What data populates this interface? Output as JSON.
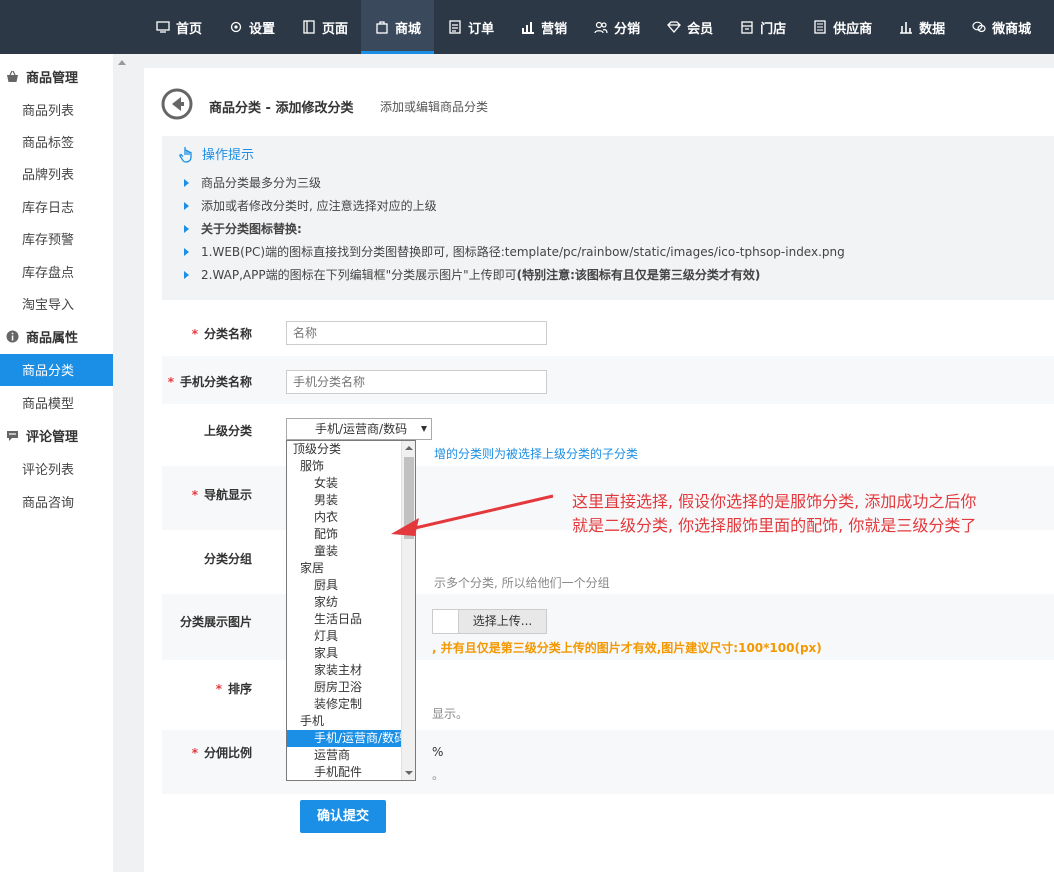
{
  "topnav": {
    "items": [
      {
        "label": "首页",
        "icon": "monitor-icon",
        "active": false
      },
      {
        "label": "设置",
        "icon": "gear-icon",
        "active": false
      },
      {
        "label": "页面",
        "icon": "page-icon",
        "active": false
      },
      {
        "label": "商城",
        "icon": "shopping-bag-icon",
        "active": true
      },
      {
        "label": "订单",
        "icon": "order-icon",
        "active": false
      },
      {
        "label": "营销",
        "icon": "bar-chart-icon",
        "active": false
      },
      {
        "label": "分销",
        "icon": "users-icon",
        "active": false
      },
      {
        "label": "会员",
        "icon": "diamond-icon",
        "active": false
      },
      {
        "label": "门店",
        "icon": "store-icon",
        "active": false
      },
      {
        "label": "供应商",
        "icon": "document-icon",
        "active": false
      },
      {
        "label": "数据",
        "icon": "stats-icon",
        "active": false
      },
      {
        "label": "微商城",
        "icon": "wechat-icon",
        "active": false
      }
    ],
    "accent": "#1b8fe6"
  },
  "sidebar": {
    "groups": [
      {
        "label": "商品管理",
        "icon": "basket-icon",
        "items": [
          "商品列表",
          "商品标签",
          "品牌列表",
          "库存日志",
          "库存预警",
          "库存盘点",
          "淘宝导入"
        ]
      },
      {
        "label": "商品属性",
        "icon": "info-icon",
        "items": [
          "商品分类",
          "商品模型"
        ]
      },
      {
        "label": "评论管理",
        "icon": "comment-icon",
        "items": [
          "评论列表",
          "商品咨询"
        ]
      }
    ],
    "active_item": "商品分类"
  },
  "header": {
    "title": "商品分类 - 添加修改分类",
    "subtitle": "添加或编辑商品分类"
  },
  "tips": {
    "title": "操作提示",
    "items": [
      {
        "text": "商品分类最多分为三级",
        "bold": false
      },
      {
        "text": "添加或者修改分类时, 应注意选择对应的上级",
        "bold": false
      },
      {
        "text": "关于分类图标替换:",
        "bold": true
      },
      {
        "text": "1.WEB(PC)端的图标直接找到分类图替换即可, 图标路径:template/pc/rainbow/static/images/ico-tphsop-index.png",
        "bold": false
      },
      {
        "text": "2.WAP,APP端的图标在下列编辑框\"分类展示图片\"上传即可",
        "bold": false,
        "bold_suffix": "(特别注意:该图标有且仅是第三级分类才有效)"
      }
    ]
  },
  "form": {
    "name": {
      "label": "分类名称",
      "placeholder": "名称",
      "required": true
    },
    "mobile_name": {
      "label": "手机分类名称",
      "placeholder": "手机分类名称",
      "required": true
    },
    "parent": {
      "label": "上级分类",
      "selected": "手机/运营商/数码",
      "hint": "增的分类则为被选择上级分类的子分类"
    },
    "nav_display": {
      "label": "导航显示",
      "required": true
    },
    "group": {
      "label": "分类分组",
      "hint": "示多个分类, 所以给他们一个分组"
    },
    "image": {
      "label": "分类展示图片",
      "button": "选择上传...",
      "hint": ", 并有且仅是第三级分类上传的图片才有效,图片建议尺寸:100*100(px)"
    },
    "sort": {
      "label": "排序",
      "required": true,
      "hint": "显示。"
    },
    "commission": {
      "label": "分佣比例",
      "required": true,
      "unit": "%",
      "hint": "。"
    },
    "submit": "确认提交"
  },
  "dropdown": {
    "options": [
      {
        "label": "顶级分类",
        "level": 0
      },
      {
        "label": "服饰",
        "level": 1
      },
      {
        "label": "女装",
        "level": 2
      },
      {
        "label": "男装",
        "level": 2
      },
      {
        "label": "内衣",
        "level": 2
      },
      {
        "label": "配饰",
        "level": 2
      },
      {
        "label": "童装",
        "level": 2
      },
      {
        "label": "家居",
        "level": 1
      },
      {
        "label": "厨具",
        "level": 2
      },
      {
        "label": "家纺",
        "level": 2
      },
      {
        "label": "生活日品",
        "level": 2
      },
      {
        "label": "灯具",
        "level": 2
      },
      {
        "label": "家具",
        "level": 2
      },
      {
        "label": "家装主材",
        "level": 2
      },
      {
        "label": "厨房卫浴",
        "level": 2
      },
      {
        "label": "装修定制",
        "level": 2
      },
      {
        "label": "手机",
        "level": 1
      },
      {
        "label": "手机/运营商/数码",
        "level": 2,
        "selected": true
      },
      {
        "label": "运营商",
        "level": 2
      },
      {
        "label": "手机配件",
        "level": 2
      }
    ]
  },
  "annotation": {
    "line1": "这里直接选择, 假设你选择的是服饰分类, 添加成功之后你",
    "line2": "就是二级分类, 你选择服饰里面的配饰, 你就是三级分类了",
    "color": "#e4393c"
  }
}
